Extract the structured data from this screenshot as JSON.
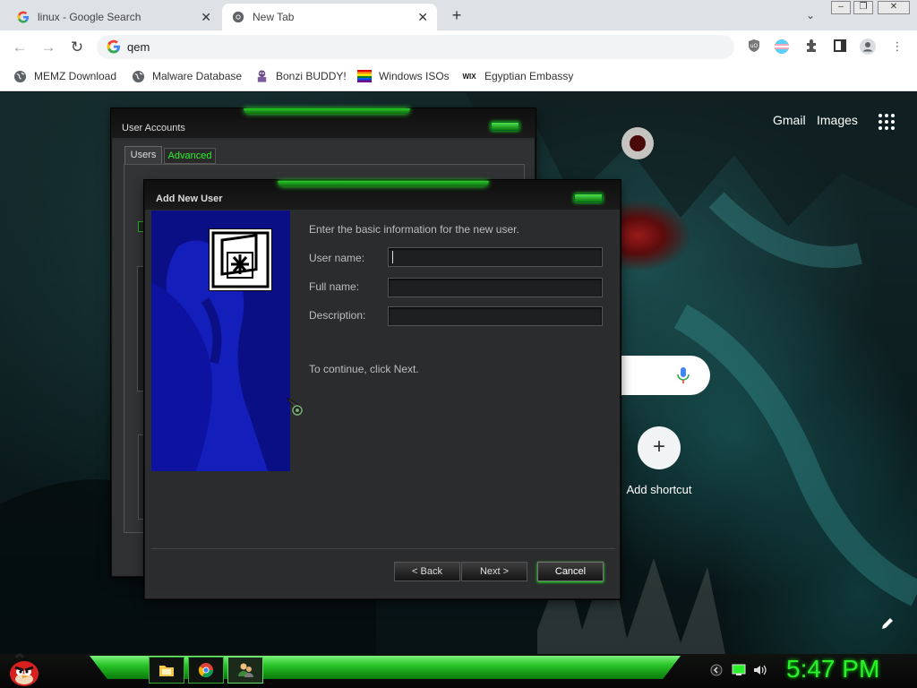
{
  "browser": {
    "tabs": [
      {
        "title": "linux - Google Search",
        "active": false
      },
      {
        "title": "New Tab",
        "active": true
      }
    ],
    "new_tab_label": "+",
    "tab_search_label": "⌄",
    "window_buttons": {
      "minimize": "–",
      "restore": "❐",
      "close": "✕"
    },
    "omnibox_text": "qem",
    "bookmarks": [
      {
        "label": "MEMZ Download",
        "icon": "globe-icon"
      },
      {
        "label": "Malware Database",
        "icon": "globe-icon"
      },
      {
        "label": "Bonzi BUDDY!",
        "icon": "bonzi-icon"
      },
      {
        "label": "Windows ISOs",
        "icon": "rainbow-flag-icon"
      },
      {
        "label": "Egyptian Embassy",
        "icon": "wix-icon",
        "icon_text": "WIX"
      }
    ]
  },
  "ntp": {
    "gmail": "Gmail",
    "images": "Images",
    "add_shortcut_label": "Add shortcut",
    "add_shortcut_icon": "+"
  },
  "user_accounts": {
    "title": "User Accounts",
    "tabs": {
      "users": "Users",
      "advanced": "Advanced"
    }
  },
  "add_new_user": {
    "title": "Add New User",
    "intro": "Enter the basic information for the new user.",
    "fields": {
      "user_name": {
        "label": "User name:",
        "value": ""
      },
      "full_name": {
        "label": "Full name:",
        "value": ""
      },
      "description": {
        "label": "Description:",
        "value": ""
      }
    },
    "continue_text": "To continue, click Next.",
    "buttons": {
      "back": "< Back",
      "next": "Next >",
      "cancel": "Cancel"
    }
  },
  "taskbar": {
    "clock": "5:47 PM",
    "accent": "#2cf02c"
  },
  "colors": {
    "accent_green": "#2cf02c",
    "dialog_bg": "#2b2c2e",
    "sidebar_blue": "#0b0f86"
  }
}
